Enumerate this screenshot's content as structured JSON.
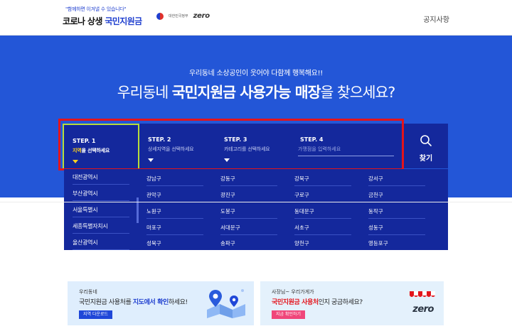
{
  "header": {
    "tagline": "\"함께하면 이겨낼 수 있습니다\"",
    "title_part1": "코로나 상생",
    "title_part2": "국민지원금",
    "partner_text": "대한민국정부",
    "partner_logo": "zero",
    "notice": "공지사항"
  },
  "hero": {
    "subtitle": "우리동네 소상공인이 웃어야 다함께 행복해요!!",
    "title_pre": "우리동네",
    "title_bold": "국민지원금 사용가능 매장",
    "title_post": "을 찾으세요?"
  },
  "search": {
    "steps": [
      {
        "label": "STEP. 1",
        "desc_hl": "지역",
        "desc": "을 선택하세요"
      },
      {
        "label": "STEP. 2",
        "desc": "상세지역을 선택하세요"
      },
      {
        "label": "STEP. 3",
        "desc": "카테고리를 선택하세요"
      },
      {
        "label": "STEP. 4",
        "placeholder": "가맹점을 입력하세요"
      }
    ],
    "button_label": "찾기"
  },
  "dropdown": {
    "provinces": [
      "대전광역시",
      "부산광역시",
      "서울특별시",
      "세종특별자치시",
      "울산광역시"
    ],
    "districts": [
      [
        "강남구",
        "강동구",
        "강북구",
        "강서구"
      ],
      [
        "관악구",
        "광진구",
        "구로구",
        "금천구"
      ],
      [
        "노원구",
        "도봉구",
        "동대문구",
        "동작구"
      ],
      [
        "마포구",
        "서대문구",
        "서초구",
        "성동구"
      ],
      [
        "성북구",
        "송파구",
        "양천구",
        "영등포구"
      ]
    ]
  },
  "banners": {
    "left": {
      "small": "우리동네",
      "main_pre": "국민지원금 사용처를 ",
      "main_hl": "지도에서 확인",
      "main_post": "하세요!",
      "button": "지역 다운로드"
    },
    "right": {
      "small": "사장님~ 우리가게가",
      "main_hl": "국민지원금 사용처",
      "main_post": "인지 궁금하세요?",
      "button": "지금 확인하기",
      "logo": "zero"
    }
  },
  "icons": {
    "search": "search-icon",
    "caret": "caret-down-icon",
    "map": "map-pin-icon",
    "store": "store-awning-icon"
  },
  "colors": {
    "hero_bg": "#2356d7",
    "search_bg": "#14289c",
    "active_border": "#b8dd3a",
    "highlight_outline": "#e3141b",
    "accent_yellow": "#ffd21f"
  }
}
